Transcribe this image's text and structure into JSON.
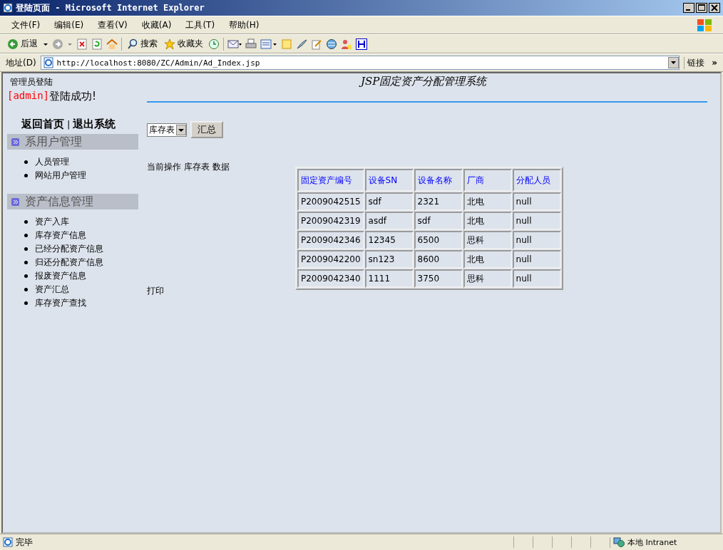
{
  "window": {
    "title": "登陆页面 - Microsoft Internet Explorer"
  },
  "menu_bar": [
    "文件(F)",
    "编辑(E)",
    "查看(V)",
    "收藏(A)",
    "工具(T)",
    "帮助(H)"
  ],
  "toolbar": {
    "back_label": "后退",
    "search_label": "搜索",
    "favorites_label": "收藏夹"
  },
  "address_bar": {
    "label": "地址(D)",
    "url": "http://localhost:8080/ZC/Admin/Ad_Index.jsp",
    "links_label": "链接",
    "more": "»"
  },
  "header": {
    "caption": "管理员登陆",
    "user": "[admin]",
    "message": "登陆成功!",
    "site_title": "JSP固定资产分配管理系统"
  },
  "nav_links": [
    {
      "label": "返回首页"
    },
    {
      "label": "退出系统"
    }
  ],
  "nav_separator": "|",
  "sidebar": [
    {
      "title": "系用户管理",
      "items": [
        "人员管理",
        "网站用户管理"
      ]
    },
    {
      "title": "资产信息管理",
      "items": [
        "资产入库",
        "库存资产信息",
        "已经分配资产信息",
        "归还分配资产信息",
        "报废资产信息",
        "资产汇总",
        "库存资产查找"
      ]
    }
  ],
  "filter": {
    "select_value": "库存表",
    "button": "汇总"
  },
  "current_operation": "当前操作 库存表 数据",
  "table": {
    "columns": [
      "固定资产编号",
      "设备SN",
      "设备名称",
      "厂商",
      "分配人员"
    ],
    "rows": [
      [
        "P2009042515",
        "sdf",
        "2321",
        "北电",
        "null"
      ],
      [
        "P2009042319",
        "asdf",
        "sdf",
        "北电",
        "null"
      ],
      [
        "P2009042346",
        "12345",
        "6500",
        "思科",
        "null"
      ],
      [
        "P2009042200",
        "sn123",
        "8600",
        "北电",
        "null"
      ],
      [
        "P2009042340",
        "1111",
        "3750",
        "思科",
        "null"
      ]
    ]
  },
  "print_link": "打印",
  "status_bar": {
    "text": "完毕",
    "zone": "本地 Intranet"
  }
}
